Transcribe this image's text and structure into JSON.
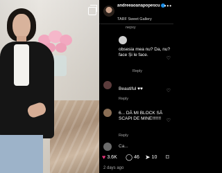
{
  "header": {
    "username": "andreeaoanapopescu",
    "subtitle": "TARF Sweet Gallery",
    "more": "•••"
  },
  "comments": [
    {
      "text": "nepxy",
      "reply": ""
    },
    {
      "text": "obsesia mea nu? Da, nu? face Și le face.",
      "reply": "Reply"
    },
    {
      "text": "Beautiful ♥♥",
      "reply": "Reply"
    },
    {
      "text": "6... DĂ MI BLOCK SĂ SCAPI DE MINE!!!!!!!",
      "reply": "Reply"
    },
    {
      "text": "Ca...",
      "reply": ""
    }
  ],
  "actions": {
    "likes": "3.6K",
    "comments": "46",
    "shares": "10"
  },
  "date": "2 days ago",
  "colors": {
    "background": "#000000",
    "accent": "#1d8fe8",
    "heart": "#e6357a"
  }
}
